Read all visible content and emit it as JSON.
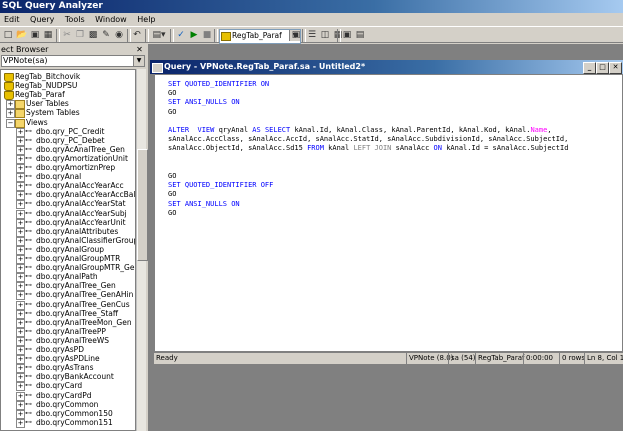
{
  "app": {
    "title": "SQL Query Analyzer"
  },
  "menu": [
    "Edit",
    "Query",
    "Tools",
    "Window",
    "Help"
  ],
  "toolbar": {
    "db_combo": "RegTab_Paraf",
    "icons": [
      "new-icon",
      "open-icon",
      "save-icon",
      "load-icon",
      "cut-icon",
      "copy-icon",
      "paste-icon",
      "clear-icon",
      "find-icon",
      "undo-icon",
      "results-mode-icon",
      "parse-icon",
      "execute-icon",
      "stop-icon",
      "object-search-icon",
      "display-plan-icon",
      "show-plan-icon",
      "object-browser-icon",
      "results-pane-icon"
    ]
  },
  "object_browser": {
    "title": "ect Browser",
    "connection": "VPNote(sa)",
    "items": [
      {
        "label": "RegTab_Bitchovik",
        "type": "db",
        "indent": 0
      },
      {
        "label": "RegTab_NUDPSU",
        "type": "db",
        "indent": 0
      },
      {
        "label": "RegTab_Paraf",
        "type": "db",
        "indent": 0
      },
      {
        "label": "User Tables",
        "type": "folder",
        "indent": 1,
        "toggle": "+"
      },
      {
        "label": "System Tables",
        "type": "folder",
        "indent": 1,
        "toggle": "+"
      },
      {
        "label": "Views",
        "type": "folder",
        "indent": 1,
        "toggle": "-"
      },
      {
        "label": "dbo.qry_PC_Credit",
        "type": "view",
        "indent": 2
      },
      {
        "label": "dbo.qry_PC_Debet",
        "type": "view",
        "indent": 2
      },
      {
        "label": "dbo.qryAcAnalTree_Gen",
        "type": "view",
        "indent": 2
      },
      {
        "label": "dbo.qryAmortizationUnit",
        "type": "view",
        "indent": 2
      },
      {
        "label": "dbo.qryAmortiznPrep",
        "type": "view",
        "indent": 2
      },
      {
        "label": "dbo.qryAnal",
        "type": "view",
        "indent": 2
      },
      {
        "label": "dbo.qryAnalAccYearAcc",
        "type": "view",
        "indent": 2
      },
      {
        "label": "dbo.qryAnalAccYearAccBal",
        "type": "view",
        "indent": 2
      },
      {
        "label": "dbo.qryAnalAccYearStat",
        "type": "view",
        "indent": 2
      },
      {
        "label": "dbo.qryAnalAccYearSubj",
        "type": "view",
        "indent": 2
      },
      {
        "label": "dbo.qryAnalAccYearUnit",
        "type": "view",
        "indent": 2
      },
      {
        "label": "dbo.qryAnalAttributes",
        "type": "view",
        "indent": 2
      },
      {
        "label": "dbo.qryAnalClassifierGroup",
        "type": "view",
        "indent": 2
      },
      {
        "label": "dbo.qryAnalGroup",
        "type": "view",
        "indent": 2
      },
      {
        "label": "dbo.qryAnalGroupMTR",
        "type": "view",
        "indent": 2
      },
      {
        "label": "dbo.qryAnalGroupMTR_Gen",
        "type": "view",
        "indent": 2
      },
      {
        "label": "dbo.qryAnalPath",
        "type": "view",
        "indent": 2
      },
      {
        "label": "dbo.qryAnalTree_Gen",
        "type": "view",
        "indent": 2
      },
      {
        "label": "dbo.qryAnalTree_GenAHin",
        "type": "view",
        "indent": 2
      },
      {
        "label": "dbo.qryAnalTree_GenCus",
        "type": "view",
        "indent": 2
      },
      {
        "label": "dbo.qryAnalTree_Staff",
        "type": "view",
        "indent": 2
      },
      {
        "label": "dbo.qryAnalTreeMon_Gen",
        "type": "view",
        "indent": 2
      },
      {
        "label": "dbo.qryAnalTreePP",
        "type": "view",
        "indent": 2
      },
      {
        "label": "dbo.qryAnalTreeWS",
        "type": "view",
        "indent": 2
      },
      {
        "label": "dbo.qryAsPD",
        "type": "view",
        "indent": 2
      },
      {
        "label": "dbo.qryAsPDLine",
        "type": "view",
        "indent": 2
      },
      {
        "label": "dbo.qryAsTrans",
        "type": "view",
        "indent": 2
      },
      {
        "label": "dbo.qryBankAccount",
        "type": "view",
        "indent": 2
      },
      {
        "label": "dbo.qryCard",
        "type": "view",
        "indent": 2
      },
      {
        "label": "dbo.qryCardPd",
        "type": "view",
        "indent": 2
      },
      {
        "label": "dbo.qryCommon",
        "type": "view",
        "indent": 2
      },
      {
        "label": "dbo.qryCommon150",
        "type": "view",
        "indent": 2
      },
      {
        "label": "dbo.qryCommon151",
        "type": "view",
        "indent": 2
      }
    ]
  },
  "query_window": {
    "title": "Query - VPNote.RegTab_Paraf.sa - Untitled2*",
    "lines": [
      [
        {
          "t": "SET QUOTED_IDENTIFIER ON",
          "c": "kw"
        }
      ],
      [
        {
          "t": "GO",
          "c": ""
        }
      ],
      [
        {
          "t": "SET ANSI_NULLS ON",
          "c": "kw"
        }
      ],
      [
        {
          "t": "GO",
          "c": ""
        }
      ],
      [
        {
          "t": "",
          "c": ""
        }
      ],
      [
        {
          "t": "ALTER  VIEW ",
          "c": "kw"
        },
        {
          "t": "qryAnal ",
          "c": ""
        },
        {
          "t": "AS SELECT ",
          "c": "kw"
        },
        {
          "t": "kAnal.Id, kAnal.Class, kAnal.ParentId, kAnal.Kod, kAnal.",
          "c": ""
        },
        {
          "t": "Name",
          "c": "fn"
        },
        {
          "t": ",",
          "c": ""
        }
      ],
      [
        {
          "t": "sAnalAcc.AccClass, sAnalAcc.AccId, sAnalAcc.StatId, sAnalAcc.SubdivisionId, sAnalAcc.SubjectId,",
          "c": ""
        }
      ],
      [
        {
          "t": "sAnalAcc.ObjectId, sAnalAcc.Sd15 ",
          "c": ""
        },
        {
          "t": "FROM ",
          "c": "kw"
        },
        {
          "t": "kAnal ",
          "c": ""
        },
        {
          "t": "LEFT JOIN ",
          "c": "gr"
        },
        {
          "t": "sAnalAcc ",
          "c": ""
        },
        {
          "t": "ON ",
          "c": "kw"
        },
        {
          "t": "kAnal.Id = sAnalAcc.SubjectId",
          "c": ""
        }
      ],
      [
        {
          "t": "",
          "c": ""
        }
      ],
      [
        {
          "t": "",
          "c": ""
        }
      ],
      [
        {
          "t": "GO",
          "c": ""
        }
      ],
      [
        {
          "t": "SET QUOTED_IDENTIFIER OFF",
          "c": "kw"
        }
      ],
      [
        {
          "t": "GO",
          "c": ""
        }
      ],
      [
        {
          "t": "SET ANSI_NULLS ON",
          "c": "kw"
        }
      ],
      [
        {
          "t": "GO",
          "c": ""
        }
      ]
    ]
  },
  "status": {
    "ready": "Ready",
    "server": "VPNote (8.0)",
    "user": "sa (54)",
    "db": "RegTab_Paraf",
    "time": "0:00:00",
    "rows": "0 rows",
    "pos": "Ln 8, Col 1"
  }
}
